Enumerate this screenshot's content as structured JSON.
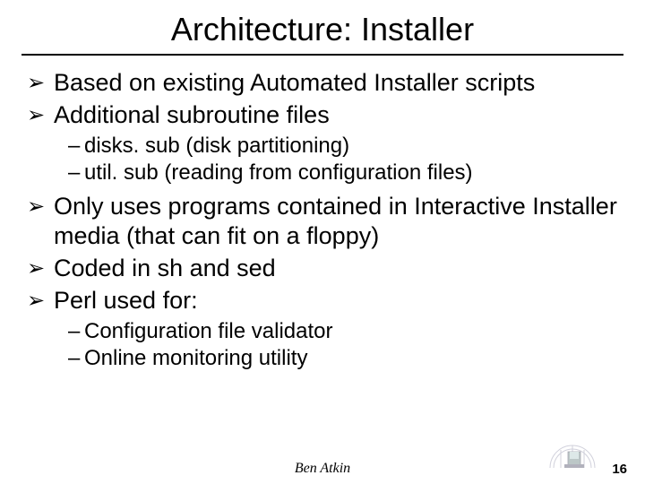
{
  "title": "Architecture: Installer",
  "bullets": [
    {
      "text": "Based on existing Automated Installer scripts"
    },
    {
      "text": "Additional subroutine files",
      "subs": [
        "disks. sub (disk partitioning)",
        "util. sub (reading from configuration files)"
      ]
    },
    {
      "text": "Only uses programs contained in Interactive Installer media (that can fit on a floppy)"
    },
    {
      "text": "Coded in sh and sed"
    },
    {
      "text": "Perl used for:",
      "subs": [
        "Configuration file validator",
        "Online monitoring utility"
      ]
    }
  ],
  "author": "Ben Atkin",
  "page": "16"
}
